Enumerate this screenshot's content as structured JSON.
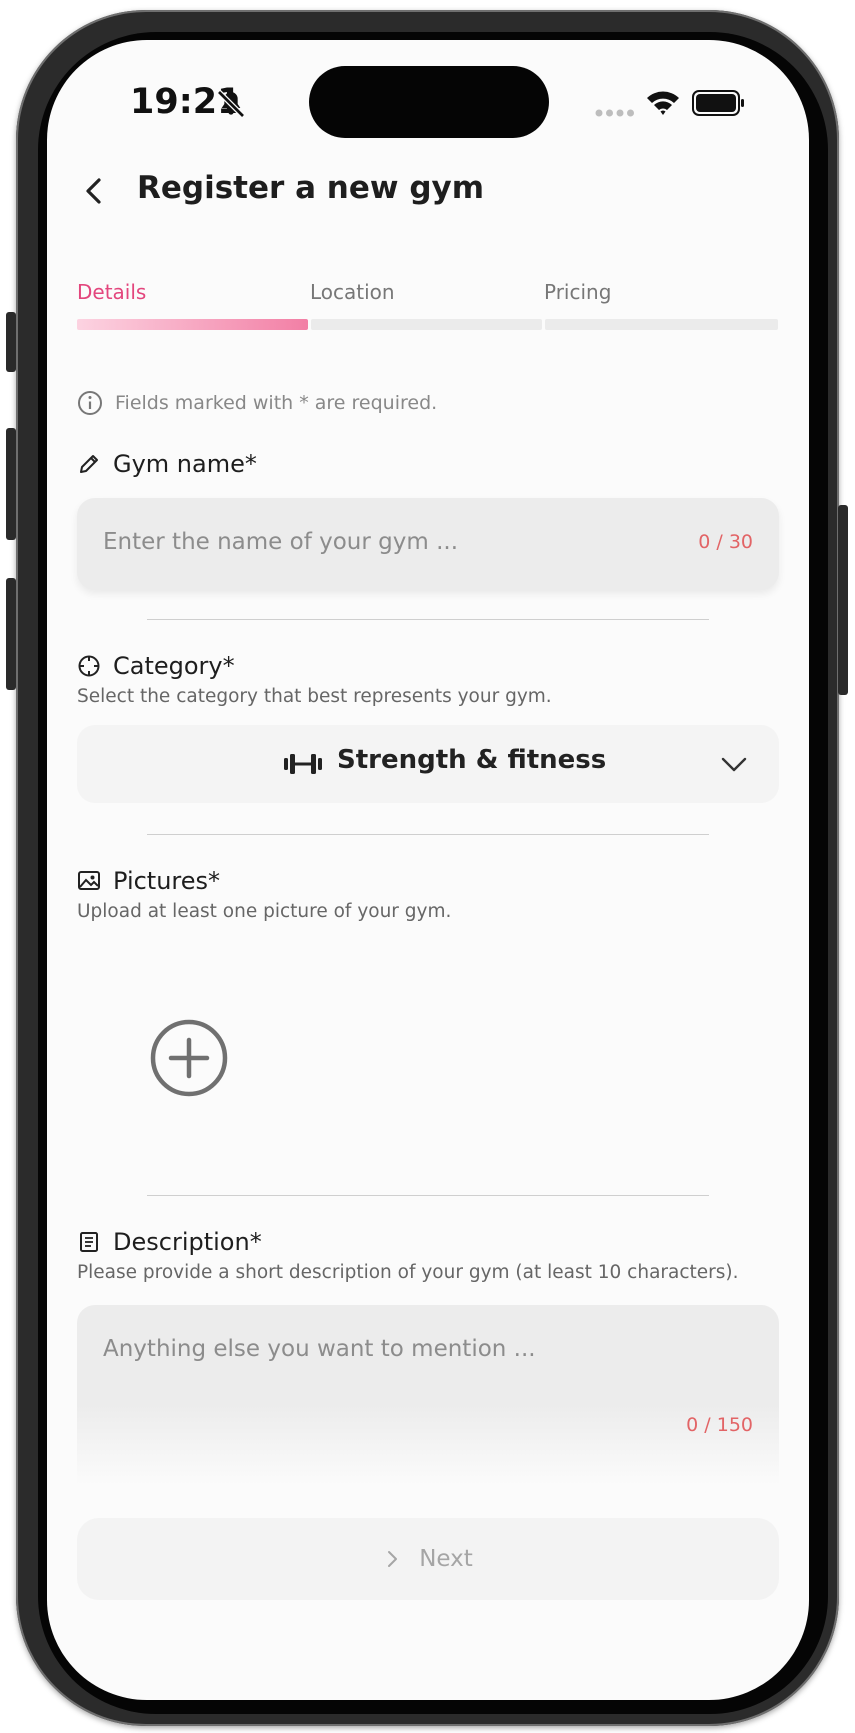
{
  "status_bar": {
    "time": "19:21"
  },
  "header": {
    "title": "Register a new gym"
  },
  "steps": [
    {
      "label": "Details",
      "active": true
    },
    {
      "label": "Location",
      "active": false
    },
    {
      "label": "Pricing",
      "active": false
    }
  ],
  "info": {
    "text": "Fields marked with * are required."
  },
  "gym_name": {
    "title": "Gym name*",
    "placeholder": "Enter the name of your gym ...",
    "counter": "0 / 30"
  },
  "category": {
    "title": "Category*",
    "subtitle": "Select the category that best represents your gym.",
    "selected": "Strength & fitness"
  },
  "pictures": {
    "title": "Pictures*",
    "subtitle": "Upload at least one picture of your gym."
  },
  "description": {
    "title": "Description*",
    "subtitle": "Please provide a short description of your gym (at least 10 characters).",
    "placeholder": "Anything else you want to mention ...",
    "counter": "0 / 150"
  },
  "next_button": {
    "label": "Next"
  },
  "colors": {
    "accent": "#e3467d",
    "counter": "#e26466"
  }
}
